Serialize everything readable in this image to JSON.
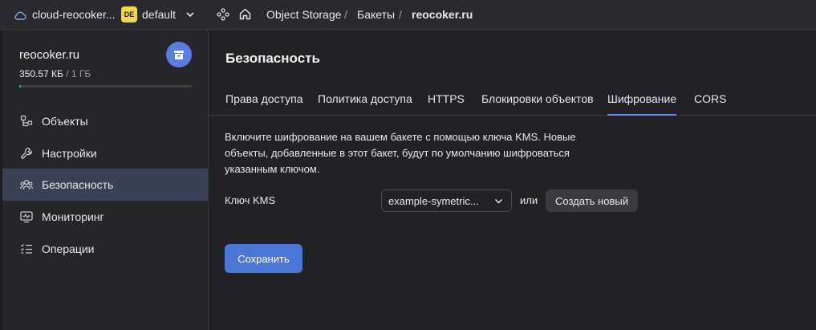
{
  "topbar": {
    "cloud_name": "cloud-reocoker...",
    "folder_badge": "DE",
    "folder_name": "default",
    "breadcrumb": [
      {
        "label": "Object Storage"
      },
      {
        "label": "Бакеты"
      },
      {
        "label": "reocoker.ru"
      }
    ],
    "separator": "/"
  },
  "sidebar": {
    "bucket_name": "reocoker.ru",
    "used": "350.57 КБ",
    "quota": " / 1 ГБ",
    "usage_fraction": 0.004,
    "items": [
      {
        "label": "Объекты",
        "icon": "objects-icon"
      },
      {
        "label": "Настройки",
        "icon": "wrench-icon"
      },
      {
        "label": "Безопасность",
        "icon": "users-icon",
        "active": true
      },
      {
        "label": "Мониторинг",
        "icon": "monitor-icon"
      },
      {
        "label": "Операции",
        "icon": "list-icon"
      }
    ]
  },
  "main": {
    "title": "Безопасность",
    "tabs": [
      {
        "label": "Права доступа"
      },
      {
        "label": "Политика доступа"
      },
      {
        "label": "HTTPS"
      },
      {
        "label": "Блокировки объектов"
      },
      {
        "label": "Шифрование",
        "active": true
      },
      {
        "label": "CORS"
      }
    ],
    "description": "Включите шифрование на вашем бакете с помощью ключа KMS. Новые объекты, добавленные в этот бакет, будут по умолчанию шифроваться указанным ключом.",
    "kms_label": "Ключ KMS",
    "kms_value": "example-symetric...",
    "or_text": "или",
    "create_label": "Создать новый",
    "save_label": "Сохранить"
  },
  "colors": {
    "accent": "#4a77d6",
    "tab_indicator": "#5a8df0",
    "active_nav": "#3b4154",
    "progress": "#3fbf6a",
    "badge": "#f0d84a"
  }
}
